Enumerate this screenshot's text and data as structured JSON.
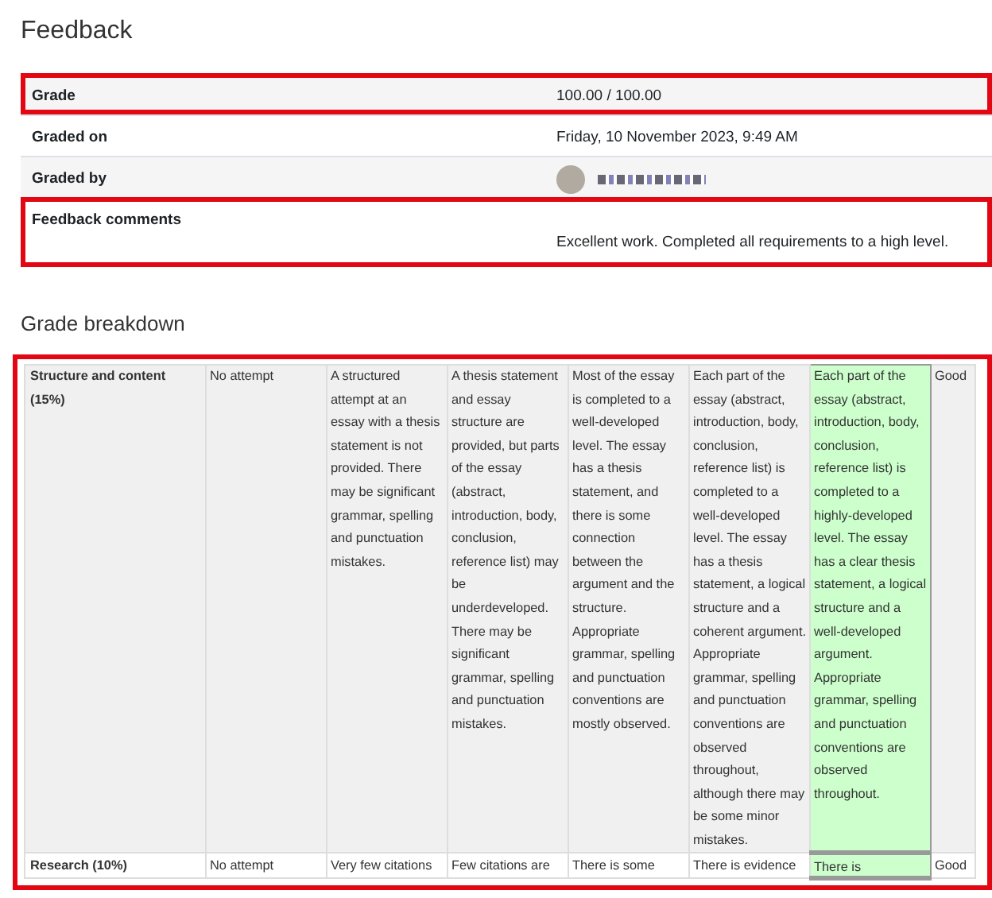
{
  "title": "Feedback",
  "feedback_rows": [
    {
      "label": "Grade",
      "value": "100.00 / 100.00",
      "highlighted": true,
      "kind": "text"
    },
    {
      "label": "Graded on",
      "value": "Friday, 10 November 2023, 9:49 AM",
      "highlighted": false,
      "kind": "text"
    },
    {
      "label": "Graded by",
      "highlighted": false,
      "kind": "user"
    },
    {
      "label": "Feedback comments",
      "value": "Excellent work. Completed all requirements to a high level.",
      "highlighted": true,
      "kind": "comment"
    }
  ],
  "grade_breakdown": {
    "title": "Grade breakdown",
    "highlighted": true,
    "criteria": [
      {
        "name": "Structure and content (15%)",
        "remark": "Good",
        "levels": [
          {
            "text": "No attempt",
            "selected": false
          },
          {
            "text": "A structured attempt at an essay with a thesis statement is not provided. There may be significant grammar, spelling and punctuation mistakes.",
            "selected": false
          },
          {
            "text": "A thesis statement and essay structure are provided, but parts of the essay (abstract, introduction, body, conclusion, reference list) may be underdeveloped. There may be significant grammar, spelling and punctuation mistakes.",
            "selected": false
          },
          {
            "text": "Most of the essay is completed to a well-developed level. The essay has a thesis statement, and there is some connection between the argument and the structure. Appropriate grammar, spelling and punctuation conventions are mostly observed.",
            "selected": false
          },
          {
            "text": "Each part of the essay (abstract, introduction, body, conclusion, reference list) is completed to a well-developed level. The essay has a thesis statement, a logical structure and a coherent argument. Appropriate grammar, spelling and punctuation conventions are observed throughout, although there may be some minor mistakes.",
            "selected": false
          },
          {
            "text": "Each part of the essay (abstract, introduction, body, conclusion, reference list) is completed to a highly-developed level. The essay has a clear thesis statement, a logical structure and a well-developed argument. Appropriate grammar, spelling and punctuation conventions are observed throughout.",
            "selected": true
          }
        ]
      },
      {
        "name": "Research (10%)",
        "remark": "Good",
        "levels": [
          {
            "text": "No attempt",
            "selected": false
          },
          {
            "text": "Very few citations",
            "selected": false
          },
          {
            "text": "Few citations are",
            "selected": false
          },
          {
            "text": "There is some",
            "selected": false
          },
          {
            "text": "There is evidence",
            "selected": false
          },
          {
            "text": "There is",
            "selected": true
          }
        ]
      }
    ]
  }
}
